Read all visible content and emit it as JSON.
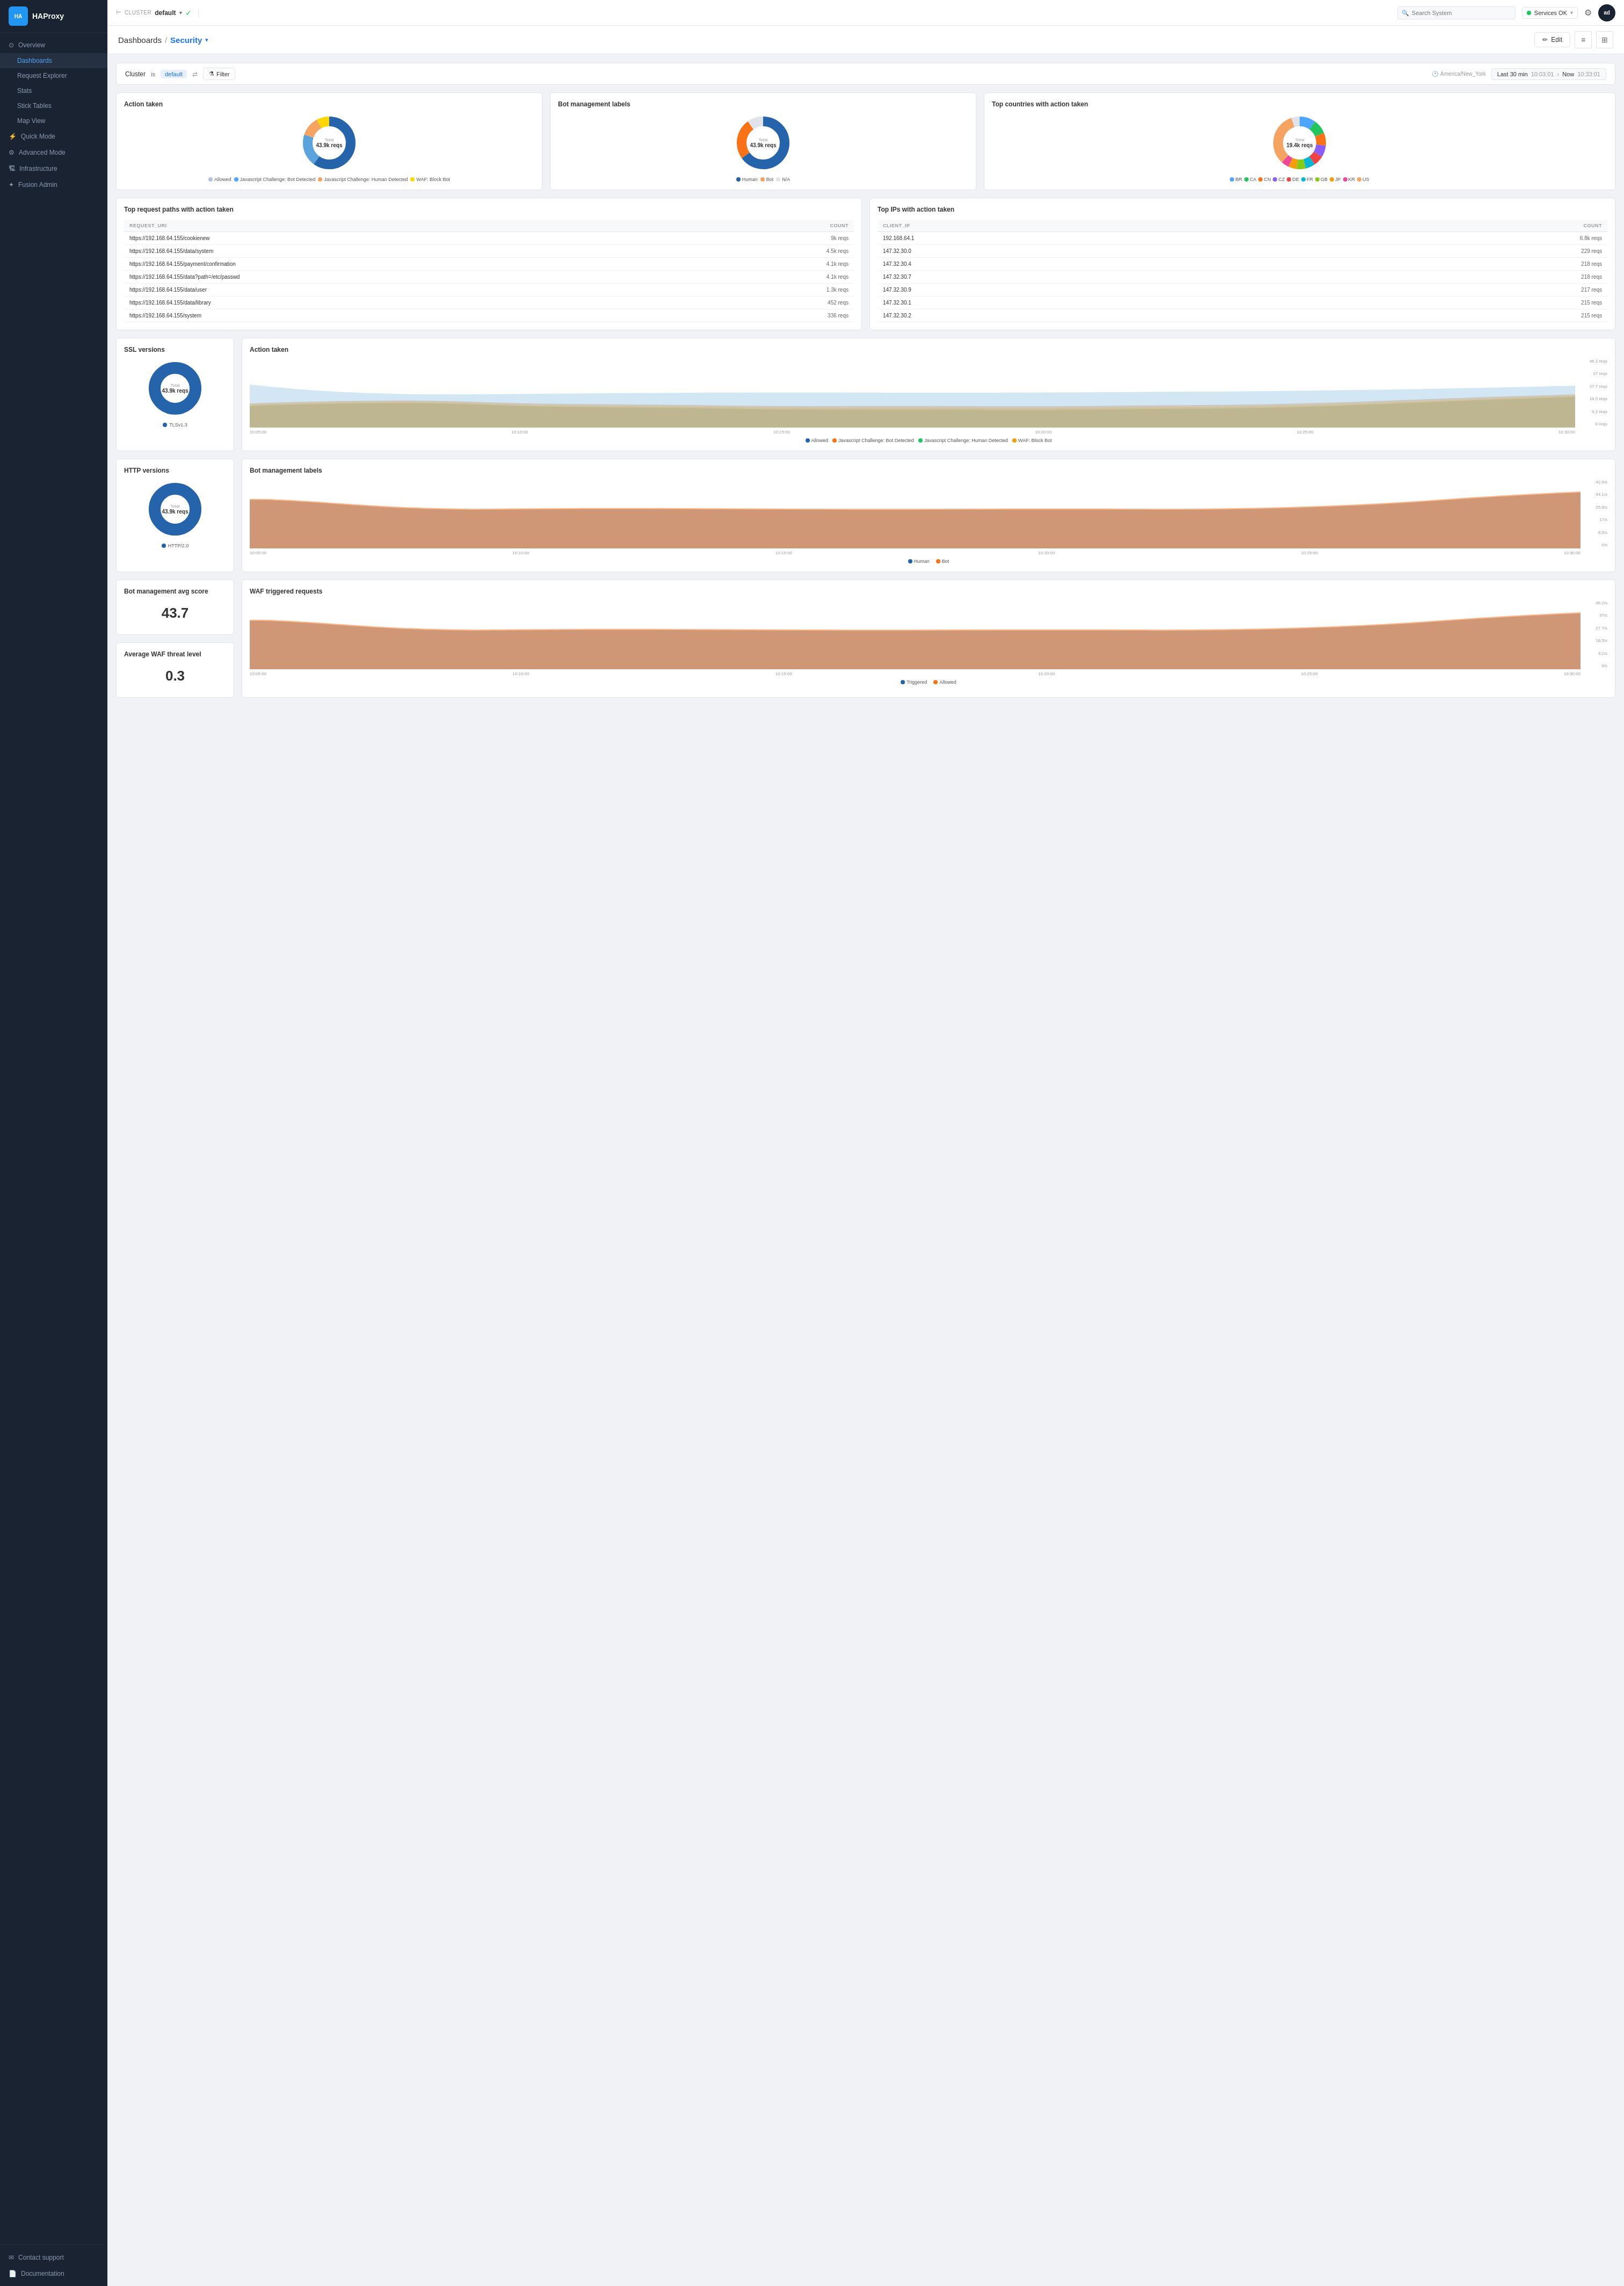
{
  "sidebar": {
    "logo": "HAProxy",
    "nav_items": [
      {
        "id": "overview",
        "label": "Overview",
        "icon": "⊙",
        "type": "parent"
      },
      {
        "id": "dashboards",
        "label": "Dashboards",
        "icon": "",
        "type": "sub",
        "active": true
      },
      {
        "id": "request-explorer",
        "label": "Request Explorer",
        "icon": "",
        "type": "sub"
      },
      {
        "id": "stats",
        "label": "Stats",
        "icon": "",
        "type": "sub"
      },
      {
        "id": "stick-tables",
        "label": "Stick Tables",
        "icon": "",
        "type": "sub"
      },
      {
        "id": "map-view",
        "label": "Map View",
        "icon": "",
        "type": "sub"
      },
      {
        "id": "quick-mode",
        "label": "Quick Mode",
        "icon": "⚡",
        "type": "parent"
      },
      {
        "id": "advanced-mode",
        "label": "Advanced Mode",
        "icon": "⚙",
        "type": "parent"
      },
      {
        "id": "infrastructure",
        "label": "Infrastructure",
        "icon": "🏗",
        "type": "parent"
      },
      {
        "id": "fusion-admin",
        "label": "Fusion Admin",
        "icon": "✦",
        "type": "parent"
      }
    ],
    "bottom_items": [
      {
        "id": "contact-support",
        "label": "Contact support",
        "icon": "✉"
      },
      {
        "id": "documentation",
        "label": "Documentation",
        "icon": "📄"
      }
    ]
  },
  "topbar": {
    "cluster_label": "CLUSTER",
    "cluster_name": "default",
    "search_placeholder": "Search System",
    "services_label": "Services OK",
    "gear_icon": "⚙",
    "avatar": "ad"
  },
  "header": {
    "breadcrumb_parent": "Dashboards",
    "breadcrumb_sep": "/",
    "breadcrumb_current": "Security",
    "edit_label": "Edit"
  },
  "filter": {
    "cluster_label": "Cluster",
    "cluster_op": "is",
    "cluster_val": "default",
    "filter_label": "Filter",
    "timezone": "America/New_York",
    "time_range": "Last 30 min",
    "time_start": "10:03:01",
    "time_now": "Now",
    "time_end": "10:33:01"
  },
  "action_taken": {
    "title": "Action taken",
    "total_label": "Total",
    "total_value": "43.9k reqs",
    "legend": [
      {
        "label": "Allowed",
        "color": "#b0c4de"
      },
      {
        "label": "Javascript Challenge: Bot Detected",
        "color": "#4da6ff"
      },
      {
        "label": "Javascript Challenge: Human Detected",
        "color": "#f4a460"
      },
      {
        "label": "WAF: Block Bot",
        "color": "#ffd700"
      }
    ],
    "segments": [
      {
        "value": 60,
        "color": "#2563ab"
      },
      {
        "value": 20,
        "color": "#5ba3dc"
      },
      {
        "value": 12,
        "color": "#f4a460"
      },
      {
        "value": 8,
        "color": "#ffd700"
      }
    ]
  },
  "bot_management": {
    "title": "Bot management labels",
    "total_label": "Total",
    "total_value": "43.9k reqs",
    "legend": [
      {
        "label": "Human",
        "color": "#2563ab"
      },
      {
        "label": "Bot",
        "color": "#f4a460"
      },
      {
        "label": "N/A",
        "color": "#e0e4ea"
      }
    ],
    "segments": [
      {
        "value": 65,
        "color": "#2563ab"
      },
      {
        "value": 25,
        "color": "#f4a460"
      },
      {
        "value": 10,
        "color": "#e0e4ea"
      }
    ]
  },
  "top_countries": {
    "title": "Top countries with action taken",
    "total_label": "Total",
    "total_value": "19.4k reqs",
    "legend": [
      {
        "label": "BR",
        "color": "#4da6ff"
      },
      {
        "label": "CA",
        "color": "#22c55e"
      },
      {
        "label": "CN",
        "color": "#f97316"
      },
      {
        "label": "CZ",
        "color": "#8b5cf6"
      },
      {
        "label": "DE",
        "color": "#ef4444"
      },
      {
        "label": "FR",
        "color": "#06b6d4"
      },
      {
        "label": "GB",
        "color": "#84cc16"
      },
      {
        "label": "JP",
        "color": "#f59e0b"
      },
      {
        "label": "KR",
        "color": "#ec4899"
      },
      {
        "label": "US",
        "color": "#f4a460"
      }
    ]
  },
  "top_request_paths": {
    "title": "Top request paths with action taken",
    "col_uri": "REQUEST_URI",
    "col_count": "COUNT",
    "rows": [
      {
        "uri": "https://192.168.64.155/cookienew",
        "count": "9k reqs"
      },
      {
        "uri": "https://192.168.64.155/data/system",
        "count": "4.5k reqs"
      },
      {
        "uri": "https://192.168.64.155/payment/confirmation",
        "count": "4.1k reqs"
      },
      {
        "uri": "https://192.168.64.155/data?path=/etc/passwd",
        "count": "4.1k reqs"
      },
      {
        "uri": "https://192.168.64.155/data/user",
        "count": "1.3k reqs"
      },
      {
        "uri": "https://192.168.64.155/data/library",
        "count": "452 reqs"
      },
      {
        "uri": "https://192.168.64.155/system",
        "count": "336 reqs"
      }
    ]
  },
  "top_ips": {
    "title": "Top IPs with action taken",
    "col_ip": "CLIENT_IP",
    "col_count": "COUNT",
    "rows": [
      {
        "ip": "192.168.64.1",
        "count": "6.8k reqs"
      },
      {
        "ip": "147.32.30.0",
        "count": "229 reqs"
      },
      {
        "ip": "147.32.30.4",
        "count": "218 reqs"
      },
      {
        "ip": "147.32.30.7",
        "count": "218 reqs"
      },
      {
        "ip": "147.32.30.9",
        "count": "217 reqs"
      },
      {
        "ip": "147.32.30.1",
        "count": "215 reqs"
      },
      {
        "ip": "147.32.30.2",
        "count": "215 reqs"
      }
    ]
  },
  "ssl_versions": {
    "title": "SSL versions",
    "total_label": "Total",
    "total_value": "43.9k reqs",
    "legend": [
      {
        "label": "TLSv1.3",
        "color": "#2563ab"
      }
    ],
    "segments": [
      {
        "value": 100,
        "color": "#2563ab"
      }
    ]
  },
  "action_taken_chart": {
    "title": "Action taken",
    "y_labels": [
      "46.2 reqs",
      "37 reqs",
      "27.7 reqs",
      "18.5 reqs",
      "9.2 reqs",
      "0 reqs"
    ],
    "x_labels": [
      "10:05:00",
      "10:10:00",
      "10:15:00",
      "10:20:00",
      "10:25:00",
      "10:30:00"
    ],
    "legend": [
      {
        "label": "Allowed",
        "color": "#2563ab"
      },
      {
        "label": "Javascript Challenge: Bot Detected",
        "color": "#f97316"
      },
      {
        "label": "Javascript Challenge: Human Detected",
        "color": "#22c55e"
      },
      {
        "label": "WAF: Block Bot",
        "color": "#f59e0b"
      }
    ]
  },
  "http_versions": {
    "title": "HTTP versions",
    "total_label": "Total",
    "total_value": "43.9k reqs",
    "legend": [
      {
        "label": "HTTP/2.0",
        "color": "#2563ab"
      }
    ],
    "segments": [
      {
        "value": 100,
        "color": "#2563ab"
      }
    ]
  },
  "bot_management_chart": {
    "title": "Bot management labels",
    "y_labels": [
      "42.6/s",
      "34.1/s",
      "25.6/s",
      "17/s",
      "8.5/s",
      "0/s"
    ],
    "x_labels": [
      "10:05:00",
      "10:10:00",
      "10:15:00",
      "10:20:00",
      "10:25:00",
      "10:30:00"
    ],
    "legend": [
      {
        "label": "Human",
        "color": "#2563ab"
      },
      {
        "label": "Bot",
        "color": "#f97316"
      }
    ]
  },
  "bot_avg_score": {
    "title": "Bot management avg score",
    "value": "43.7"
  },
  "waf_avg_threat": {
    "title": "Average WAF threat level",
    "value": "0.3"
  },
  "waf_triggered": {
    "title": "WAF triggered requests",
    "y_labels": [
      "46.2/s",
      "37/s",
      "27.7/s",
      "18.5/s",
      "9.2/s",
      "0/s"
    ],
    "x_labels": [
      "10:05:00",
      "10:10:00",
      "10:15:00",
      "10:20:00",
      "10:25:00",
      "10:30:00"
    ],
    "legend": [
      {
        "label": "Triggered",
        "color": "#2563ab"
      },
      {
        "label": "Allowed",
        "color": "#f97316"
      }
    ]
  }
}
